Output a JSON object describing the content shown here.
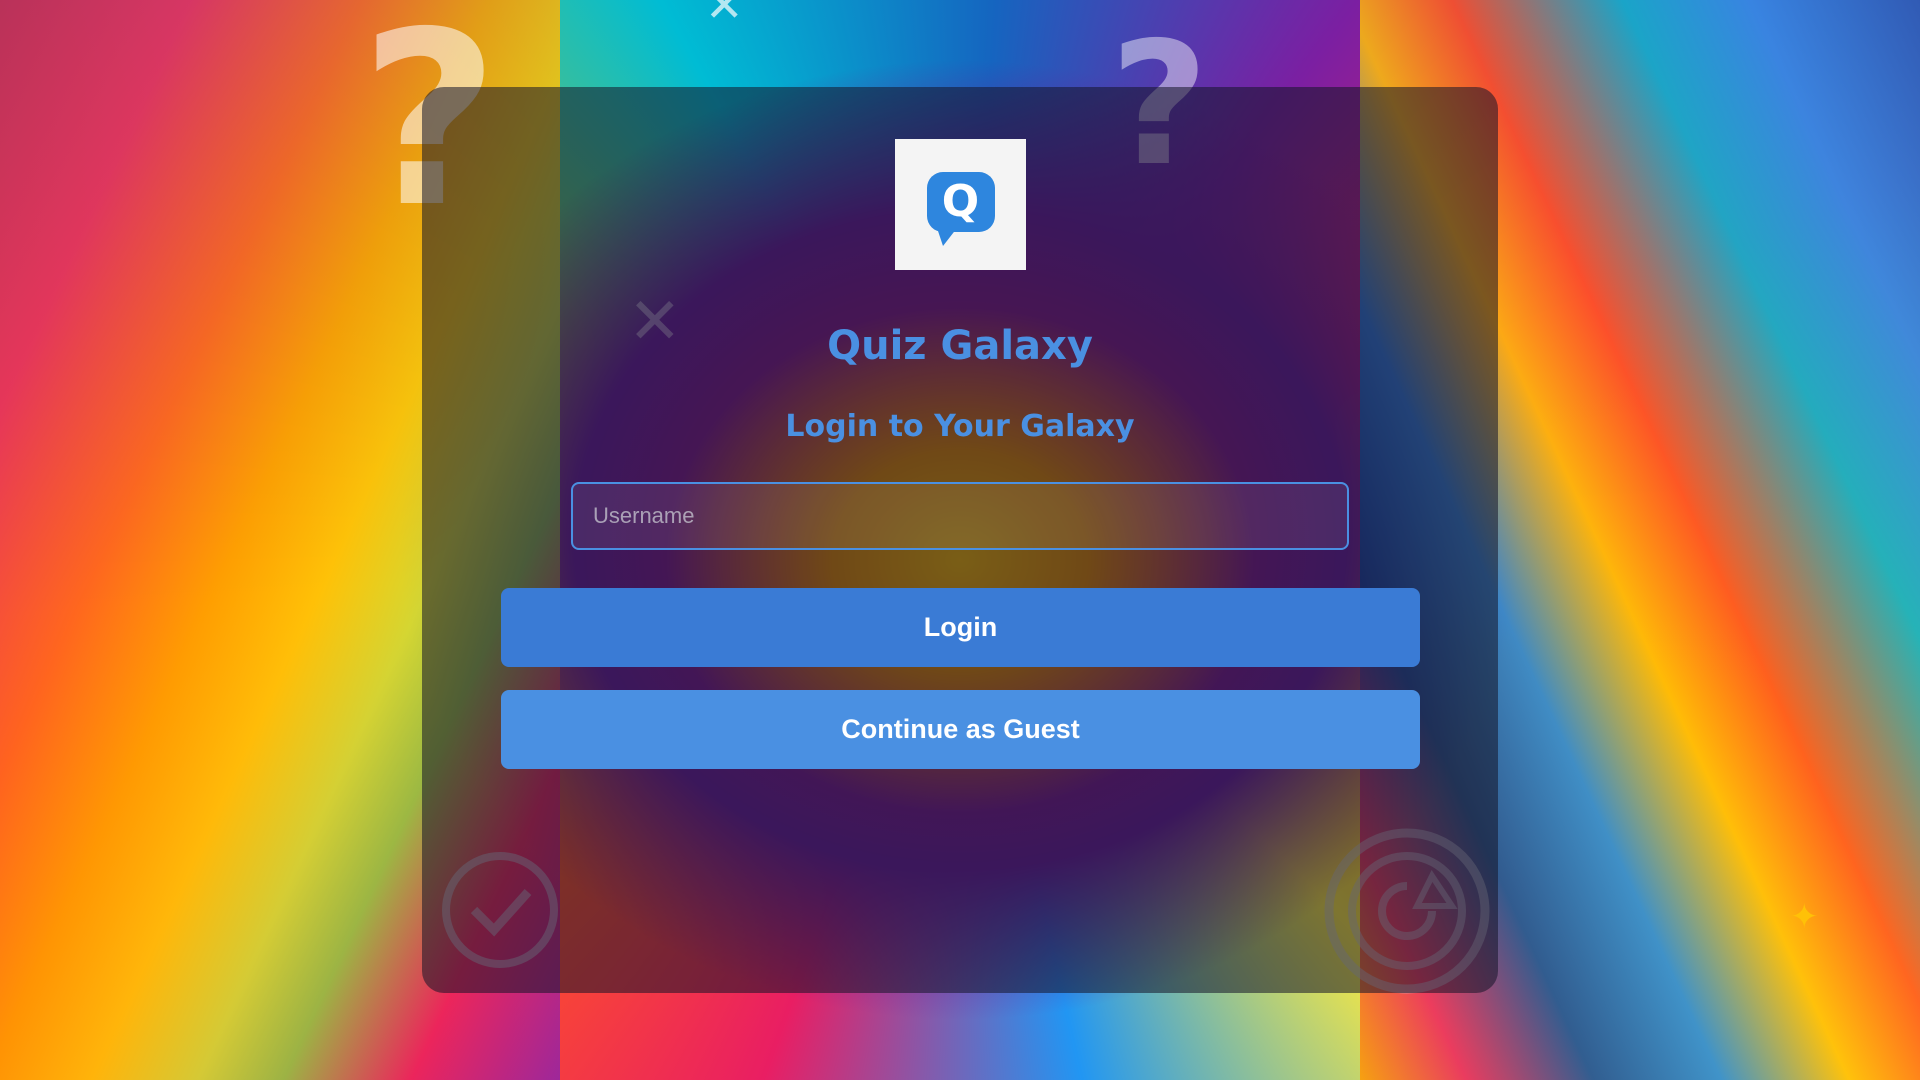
{
  "app": {
    "title": "Quiz Galaxy",
    "subtitle": "Login to Your Galaxy",
    "logo_letter": "Q"
  },
  "form": {
    "username_placeholder": "Username",
    "username_value": "",
    "login_label": "Login",
    "guest_label": "Continue as Guest"
  },
  "colors": {
    "accent": "#4a90e2",
    "login_button": "#3a7bd5",
    "guest_button": "#4a90e2",
    "card_overlay": "rgba(20,20,40,0.55)"
  },
  "icons": {
    "logo": "speech-bubble-q-icon",
    "decorations": [
      "question-mark-icon",
      "checkmark-circle-icon",
      "refresh-circle-icon",
      "x-icon",
      "star-icon"
    ]
  }
}
